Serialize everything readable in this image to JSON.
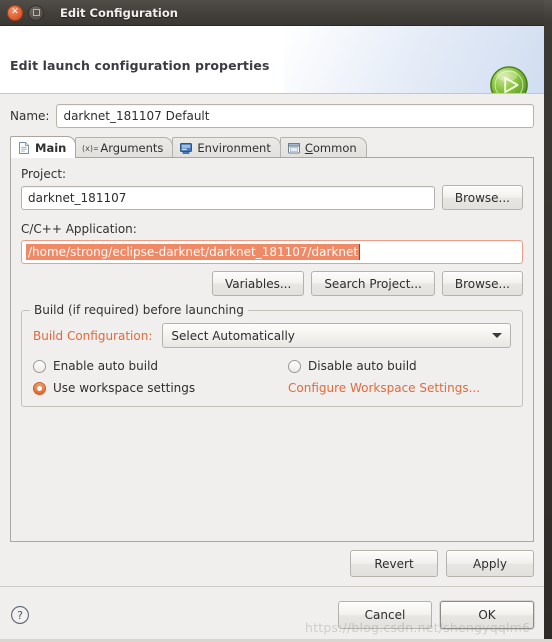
{
  "titlebar": {
    "title": "Edit Configuration",
    "close_icon": "close-icon",
    "maximize_icon": "maximize-icon"
  },
  "header": {
    "title": "Edit launch configuration properties",
    "run_icon": "run-play-icon",
    "cursor_icon": "mouse-cursor"
  },
  "name": {
    "label": "Name:",
    "value": "darknet_181107 Default"
  },
  "tabs": [
    {
      "label": "Main",
      "icon": "file-document-icon",
      "active": true
    },
    {
      "label": "Arguments",
      "icon": "arguments-xequals-icon",
      "active": false
    },
    {
      "label": "Environment",
      "icon": "environment-icon",
      "active": false
    },
    {
      "label": "Common",
      "icon": "common-window-icon",
      "active": false
    }
  ],
  "main_tab": {
    "project": {
      "label": "Project:",
      "value": "darknet_181107",
      "browse_label": "Browse..."
    },
    "application": {
      "label": "C/C++ Application:",
      "value": "/home/strong/eclipse-darknet/darknet_181107/darknet",
      "selected": true,
      "buttons": [
        "Variables...",
        "Search Project...",
        "Browse..."
      ]
    },
    "build_group": {
      "title": "Build (if required) before launching",
      "config_label": "Build Configuration:",
      "config_value": "Select Automatically",
      "radios": [
        {
          "label": "Enable auto build",
          "checked": false
        },
        {
          "label": "Disable auto build",
          "checked": false
        },
        {
          "label": "Use workspace settings",
          "checked": true
        }
      ],
      "configure_link": "Configure Workspace Settings..."
    }
  },
  "action_buttons": {
    "revert": "Revert",
    "apply": "Apply"
  },
  "footer": {
    "help_icon": "help-question-icon",
    "cancel": "Cancel",
    "ok": "OK"
  },
  "watermark": "https://blog.csdn.net/shengyqqlm6",
  "colors": {
    "accent_orange": "#e06a3c",
    "selection": "#f08a66",
    "titlebar": "#44403c",
    "window_bg": "#f0efed"
  }
}
